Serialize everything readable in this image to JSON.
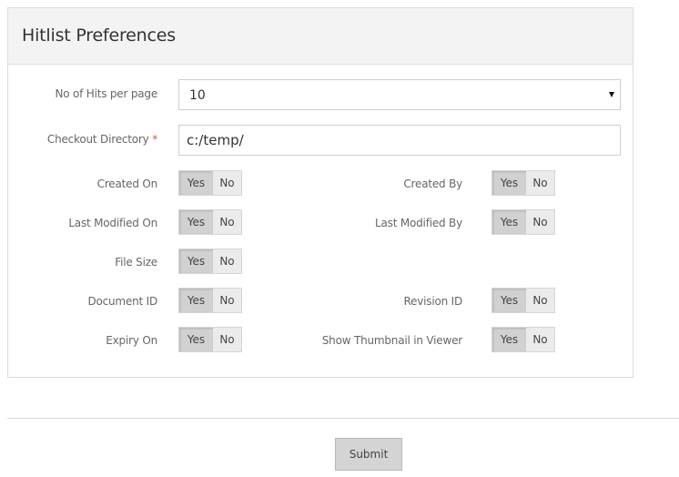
{
  "panel": {
    "title": "Hitlist Preferences"
  },
  "hits_per_page": {
    "label": "No of Hits per page",
    "value": "10"
  },
  "checkout_directory": {
    "label": "Checkout Directory",
    "required_marker": "*",
    "value": "c:/temp/"
  },
  "toggles": {
    "created_on": {
      "label": "Created On",
      "yes": "Yes",
      "no": "No",
      "selected": "Yes"
    },
    "created_by": {
      "label": "Created By",
      "yes": "Yes",
      "no": "No",
      "selected": "Yes"
    },
    "last_modified_on": {
      "label": "Last Modified On",
      "yes": "Yes",
      "no": "No",
      "selected": "Yes"
    },
    "last_modified_by": {
      "label": "Last Modified By",
      "yes": "Yes",
      "no": "No",
      "selected": "Yes"
    },
    "file_size": {
      "label": "File Size",
      "yes": "Yes",
      "no": "No",
      "selected": "Yes"
    },
    "document_id": {
      "label": "Document ID",
      "yes": "Yes",
      "no": "No",
      "selected": "Yes"
    },
    "revision_id": {
      "label": "Revision ID",
      "yes": "Yes",
      "no": "No",
      "selected": "Yes"
    },
    "expiry_on": {
      "label": "Expiry On",
      "yes": "Yes",
      "no": "No",
      "selected": "Yes"
    },
    "show_thumbnail": {
      "label": "Show Thumbnail in Viewer",
      "yes": "Yes",
      "no": "No",
      "selected": "Yes"
    }
  },
  "footer": {
    "submit_label": "Submit"
  },
  "colors": {
    "required": "#d9534f",
    "header_bg": "#f3f3f3",
    "toggle_active": "#d1d1d1",
    "toggle_inactive": "#ebebeb"
  }
}
